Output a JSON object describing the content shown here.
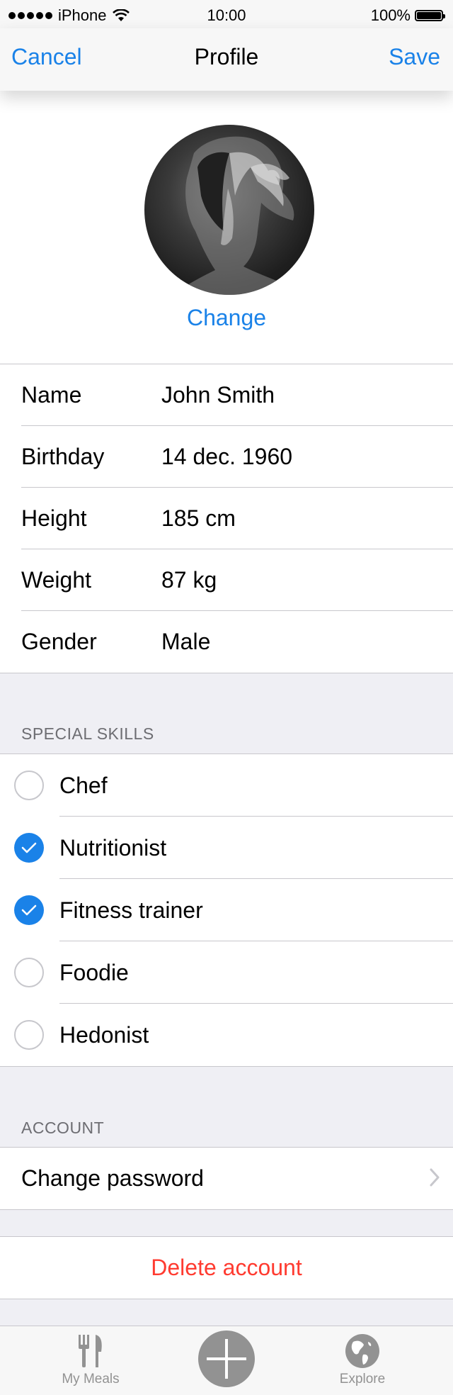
{
  "status_bar": {
    "carrier": "iPhone",
    "time": "10:00",
    "battery": "100%"
  },
  "nav": {
    "cancel": "Cancel",
    "title": "Profile",
    "save": "Save"
  },
  "profile": {
    "change_photo": "Change",
    "fields": [
      {
        "label": "Name",
        "value": "John Smith"
      },
      {
        "label": "Birthday",
        "value": "14 dec. 1960"
      },
      {
        "label": "Height",
        "value": "185 cm"
      },
      {
        "label": "Weight",
        "value": "87 kg"
      },
      {
        "label": "Gender",
        "value": "Male"
      }
    ]
  },
  "skills": {
    "header": "SPECIAL SKILLS",
    "items": [
      {
        "label": "Chef",
        "checked": false
      },
      {
        "label": "Nutritionist",
        "checked": true
      },
      {
        "label": "Fitness trainer",
        "checked": true
      },
      {
        "label": "Foodie",
        "checked": false
      },
      {
        "label": "Hedonist",
        "checked": false
      }
    ]
  },
  "account": {
    "header": "ACCOUNT",
    "change_password": "Change password",
    "delete_account": "Delete account"
  },
  "tabbar": {
    "my_meals": "My Meals",
    "add_icon": "plus-icon",
    "explore": "Explore"
  },
  "colors": {
    "accent": "#1a82e8",
    "destructive": "#ff3b30",
    "grouped_background": "#efeff4",
    "tab_inactive": "#929292"
  }
}
